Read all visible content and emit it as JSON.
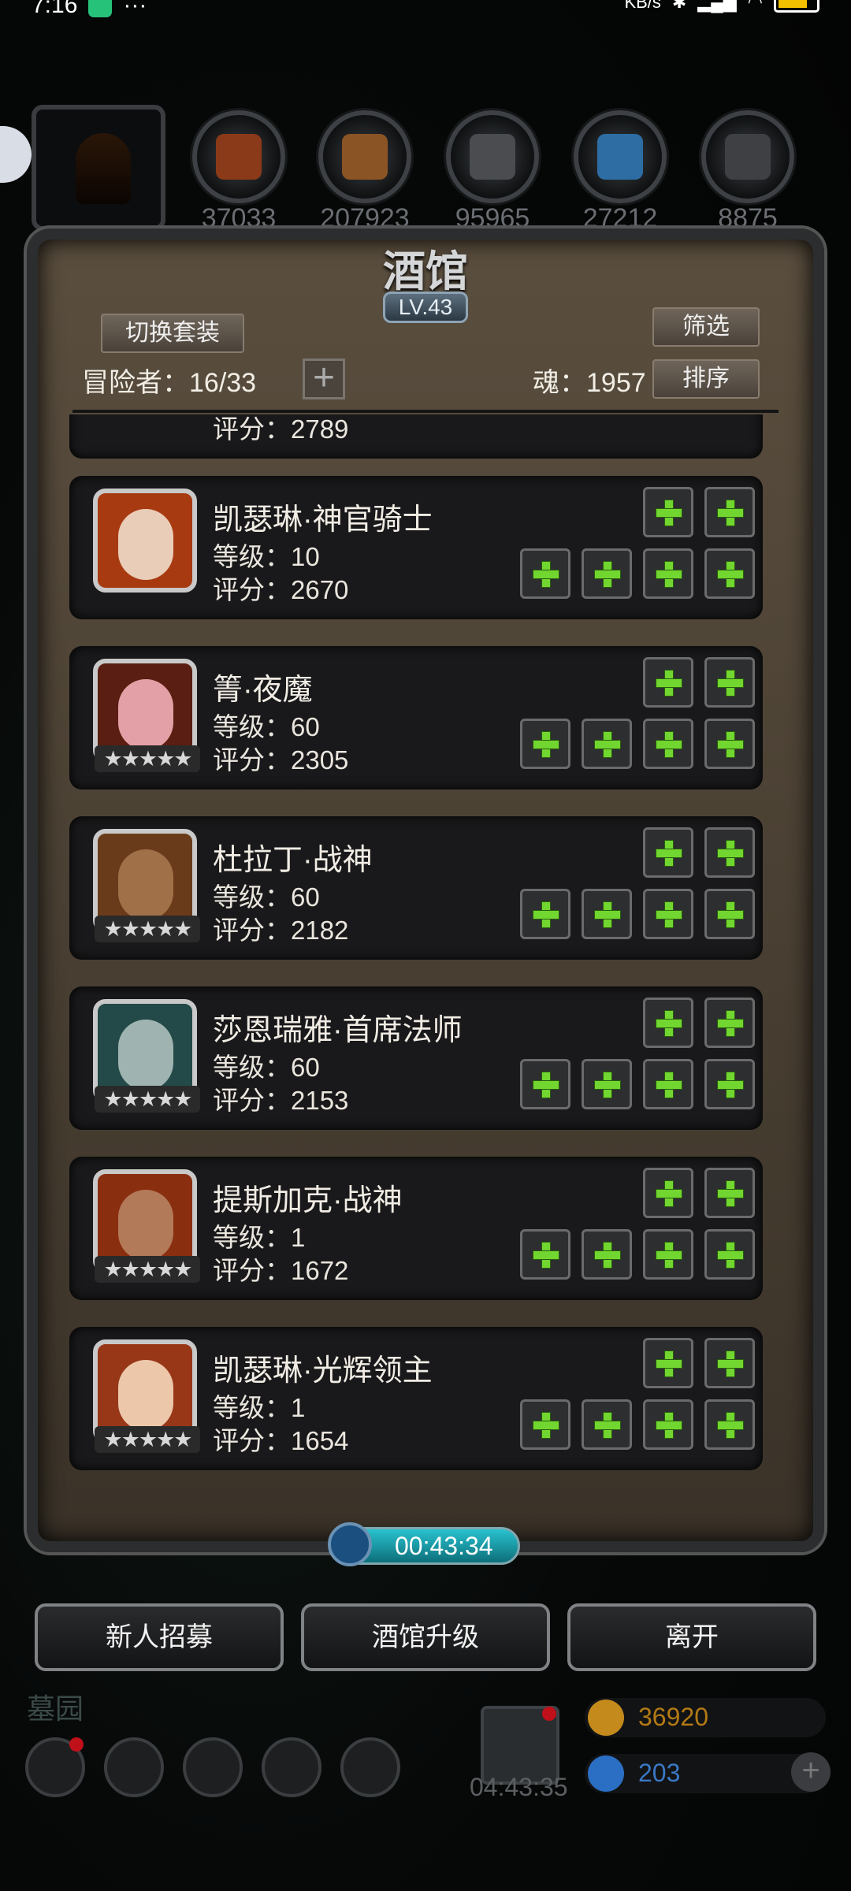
{
  "status_bar": {
    "time": "7:16",
    "net_speed": "KB/s",
    "battery": "80"
  },
  "resources": {
    "counts": [
      "37033",
      "207923",
      "95965",
      "27212",
      "8875"
    ],
    "icons": [
      "meat-icon",
      "wood-icon",
      "iron-icon",
      "crystal-icon",
      "ore-icon"
    ]
  },
  "panel": {
    "title": "酒馆",
    "level": "LV.43",
    "switch_outfit_label": "切换套装",
    "filter_label": "筛选",
    "sort_label": "排序",
    "adventurers_text": "冒险者：16/33",
    "soul_text": "魂：1957",
    "add_icon": "+"
  },
  "partial_top_card": {
    "score": "评分：2789"
  },
  "heroes": [
    {
      "name": "凯瑟琳·神官骑士",
      "level": "等级：10",
      "score": "评分：2670",
      "stars": "",
      "portrait_color": "#a83a12",
      "face_color": "#e9cdb8"
    },
    {
      "name": "箐·夜魔",
      "level": "等级：60",
      "score": "评分：2305",
      "stars": "★★★★★",
      "portrait_color": "#5a1e12",
      "face_color": "#e3a0a6"
    },
    {
      "name": "杜拉丁·战神",
      "level": "等级：60",
      "score": "评分：2182",
      "stars": "★★★★★",
      "portrait_color": "#6a3b1a",
      "face_color": "#a07048"
    },
    {
      "name": "莎恩瑞雅·首席法师",
      "level": "等级：60",
      "score": "评分：2153",
      "stars": "★★★★★",
      "portrait_color": "#234a48",
      "face_color": "#9fb4b0"
    },
    {
      "name": "提斯加克·战神",
      "level": "等级：1",
      "score": "评分：1672",
      "stars": "★★★★★",
      "portrait_color": "#8a2e10",
      "face_color": "#b27a58"
    },
    {
      "name": "凯瑟琳·光辉领主",
      "level": "等级：1",
      "score": "评分：1654",
      "stars": "★★★★★",
      "portrait_color": "#983618",
      "face_color": "#ecc7aa"
    }
  ],
  "timer": "00:43:34",
  "bottom_buttons": {
    "recruit": "新人招募",
    "upgrade": "酒馆升级",
    "leave": "离开"
  },
  "hud": {
    "area_label": "墓园",
    "gift_timer": "04:43:35",
    "gold": "36920",
    "gems": "203",
    "gold_color": "#b37a14",
    "gem_color": "#2b6fc4"
  }
}
